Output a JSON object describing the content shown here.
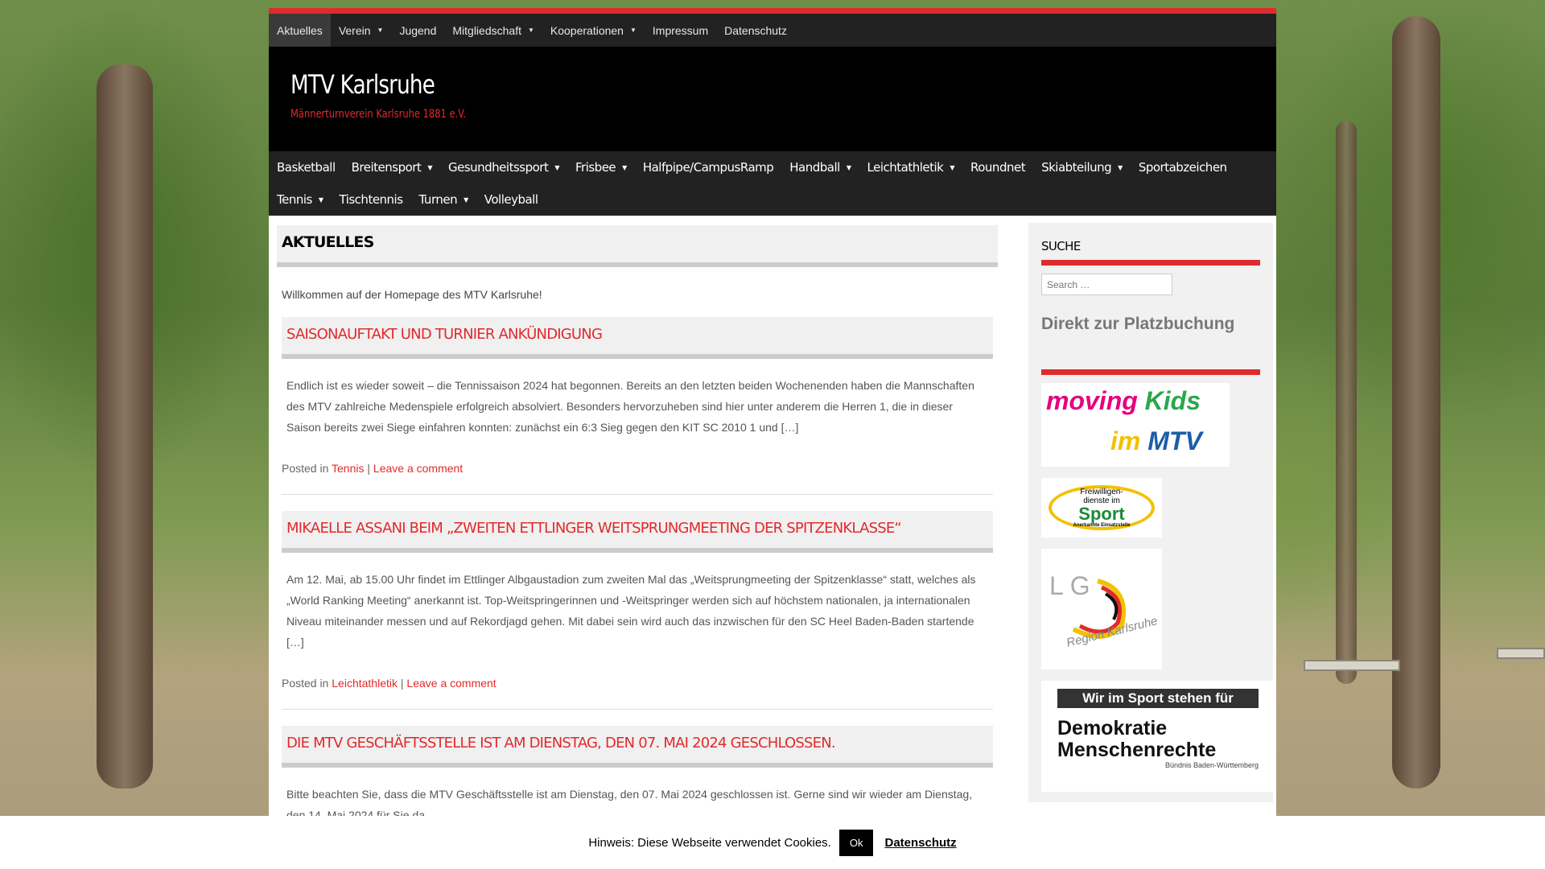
{
  "top_menu": [
    {
      "label": "Aktuelles",
      "has_children": false
    },
    {
      "label": "Verein",
      "has_children": true
    },
    {
      "label": "Jugend",
      "has_children": false
    },
    {
      "label": "Mitgliedschaft",
      "has_children": true
    },
    {
      "label": "Kooperationen",
      "has_children": true
    },
    {
      "label": "Impressum",
      "has_children": false
    },
    {
      "label": "Datenschutz",
      "has_children": false
    }
  ],
  "site": {
    "title": "MTV Karlsruhe",
    "description": "Männerturnverein Karlsruhe 1881 e.V."
  },
  "main_menu": [
    {
      "label": "Basketball",
      "has_children": false
    },
    {
      "label": "Breitensport",
      "has_children": true
    },
    {
      "label": "Gesundheitssport",
      "has_children": true
    },
    {
      "label": "Frisbee",
      "has_children": true
    },
    {
      "label": "Halfpipe/CampusRamp",
      "has_children": false
    },
    {
      "label": "Handball",
      "has_children": true
    },
    {
      "label": "Leichtathletik",
      "has_children": true
    },
    {
      "label": "Roundnet",
      "has_children": false
    },
    {
      "label": "Skiabteilung",
      "has_children": true
    },
    {
      "label": "Sportabzeichen",
      "has_children": false
    },
    {
      "label": "Tennis",
      "has_children": true
    },
    {
      "label": "Tischtennis",
      "has_children": false
    },
    {
      "label": "Turnen",
      "has_children": true
    },
    {
      "label": "Volleyball",
      "has_children": false
    }
  ],
  "page": {
    "title": "AKTUELLES",
    "welcome": "Willkommen auf der Homepage des MTV Karlsruhe!"
  },
  "posts": [
    {
      "title": "Saisonauftakt und Turnier Ankündigung",
      "excerpt": "Endlich ist es wieder soweit – die Tennissaison 2024 hat begonnen.  Bereits an den letzten beiden Wochenenden haben die Mannschaften des MTV zahlreiche Medenspiele erfolgreich absolviert. Besonders hervorzuheben sind hier unter anderem die Herren 1, die in dieser Saison bereits zwei Siege einfahren konnten: zunächst ein 6:3 Sieg gegen den KIT SC 2010 1 und […]",
      "posted_in_label": "Posted in",
      "category": "Tennis",
      "separator": "|",
      "comment_link": "Leave a comment"
    },
    {
      "title": "Mikaelle Assani beim „Zweiten Ettlinger Weitsprungmeeting der Spitzenklasse“",
      "excerpt": "Am 12. Mai, ab 15.00 Uhr findet im Ettlinger Albgaustadion zum zweiten Mal das „Weitsprungmeeting der Spitzenklasse“ statt, welches als „World Ranking Meeting“ anerkannt ist. Top-Weitspringerinnen und -Weitspringer werden sich auf höchstem nationalen, ja internationalen Niveau miteinander messen und auf Rekordjagd gehen. Mit dabei sein wird auch das inzwischen für den SC Heel Baden-Baden startende […]",
      "posted_in_label": "Posted in",
      "category": "Leichtathletik",
      "separator": "|",
      "comment_link": "Leave a comment"
    },
    {
      "title": "Die MTV Geschäftsstelle ist am Dienstag, den 07. Mai 2024 geschlossen.",
      "excerpt": "Bitte beachten Sie, dass die MTV Geschäftsstelle ist am Dienstag, den 07. Mai 2024 geschlossen ist. Gerne sind wir wieder am Dienstag, den 14. Mai 2024 für Sie da."
    }
  ],
  "sidebar": {
    "search_title": "SUCHE",
    "search_placeholder": "Search …",
    "booking_link": "Direkt zur Platzbuchung",
    "banners": {
      "moving_kids": {
        "word1": "moving",
        "word2": "Kids",
        "word3": "im",
        "word4": "MTV"
      },
      "freiwilligendienste": {
        "line1": "Freiwilligen-",
        "line2": "dienste im",
        "line3": "Sport",
        "line4": "Anerkannte Einsatzstelle"
      },
      "lg_region": {
        "line1": "LG",
        "line2": "Region Karlsruhe"
      },
      "demokratie": {
        "header": "Wir im Sport stehen für",
        "line1": "Demokratie",
        "line2": "Menschenrechte",
        "footer": "Bündnis Baden-Württemberg"
      }
    }
  },
  "cookie_notice": {
    "text": "Hinweis: Diese Webseite verwendet Cookies.",
    "ok_label": "Ok",
    "privacy_link": "Datenschutz"
  },
  "colors": {
    "accent": "#e12a2d",
    "nav_bg": "#222222",
    "header_bg": "#000000",
    "kids_magenta": "#e6007e",
    "kids_green": "#2aa84a",
    "kids_yellow": "#f2c100",
    "kids_blue": "#1d5ca8"
  },
  "icons": {
    "submenu_indicator": "caret-down-icon"
  }
}
